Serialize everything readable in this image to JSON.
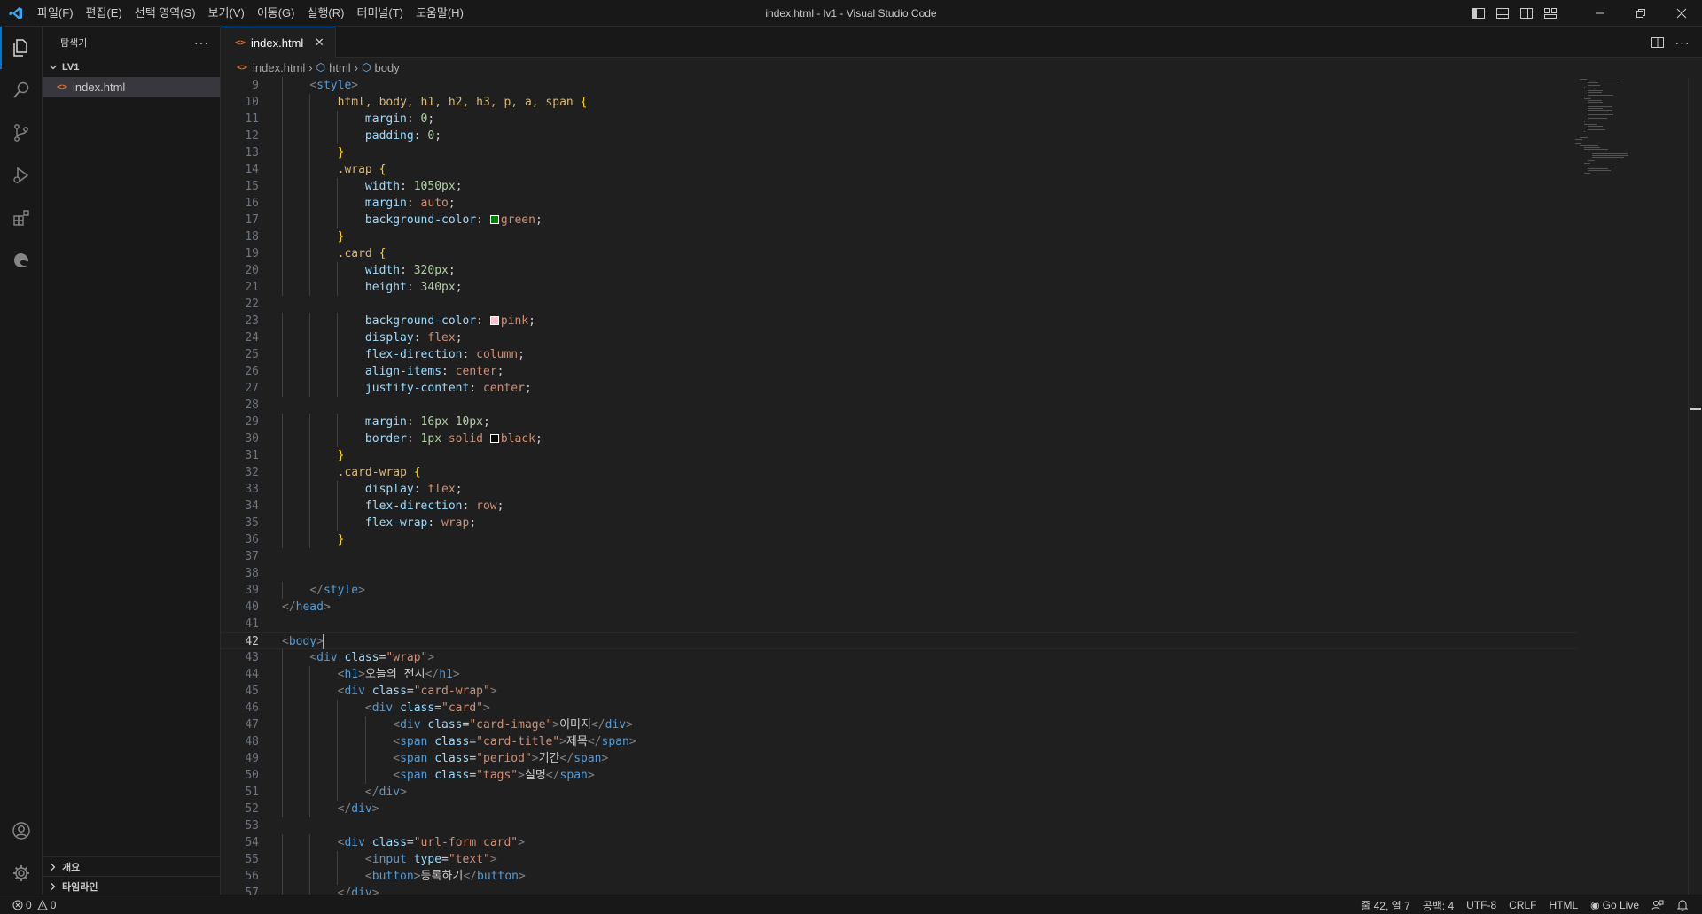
{
  "titlebar": {
    "title": "index.html - lv1 - Visual Studio Code",
    "menu": [
      "파일(F)",
      "편집(E)",
      "선택 영역(S)",
      "보기(V)",
      "이동(G)",
      "실행(R)",
      "터미널(T)",
      "도움말(H)"
    ]
  },
  "sidebar": {
    "title": "탐색기",
    "more": "···",
    "folder": "LV1",
    "file": "index.html",
    "sections": [
      "개요",
      "타임라인"
    ]
  },
  "tab": {
    "label": "index.html",
    "close": "✕"
  },
  "breadcrumb": [
    "index.html",
    "html",
    "body"
  ],
  "editor": {
    "first_line": 9,
    "current_line": 42,
    "lines": [
      "    <style>",
      "        html, body, h1, h2, h3, p, a, span {",
      "            margin: 0;",
      "            padding: 0;",
      "        }",
      "        .wrap {",
      "            width: 1050px;",
      "            margin: auto;",
      "            background-color: green;",
      "        }",
      "        .card {",
      "            width: 320px;",
      "            height: 340px;",
      "",
      "            background-color: pink;",
      "            display: flex;",
      "            flex-direction: column;",
      "            align-items: center;",
      "            justify-content: center;",
      "",
      "            margin: 16px 10px;",
      "            border: 1px solid black;",
      "        }",
      "        .card-wrap {",
      "            display: flex;",
      "            flex-direction: row;",
      "            flex-wrap: wrap;",
      "        }",
      "",
      "",
      "    </style>",
      "</head>",
      "",
      "<body>",
      "    <div class=\"wrap\">",
      "        <h1>오늘의 전시</h1>",
      "        <div class=\"card-wrap\">",
      "            <div class=\"card\">",
      "                <div class=\"card-image\">이미지</div>",
      "                <span class=\"card-title\">제목</span>",
      "                <span class=\"period\">기간</span>",
      "                <span class=\"tags\">설명</span>",
      "            </div>",
      "        </div>",
      "",
      "        <div class=\"url-form card\">",
      "            <input type=\"text\">",
      "            <button>등록하기</button>",
      "        </div>"
    ],
    "swatches": {
      "green": "#008000",
      "pink": "#ffc0cb",
      "black": "#000000"
    }
  },
  "statusbar": {
    "errors": "0",
    "warnings": "0",
    "position": "줄 42, 열 7",
    "spaces": "공백: 4",
    "encoding": "UTF-8",
    "eol": "CRLF",
    "language": "HTML",
    "golive": "Go Live"
  },
  "colors": {
    "accent": "#0078d4",
    "background": "#1f1f1f",
    "chrome": "#181818"
  }
}
